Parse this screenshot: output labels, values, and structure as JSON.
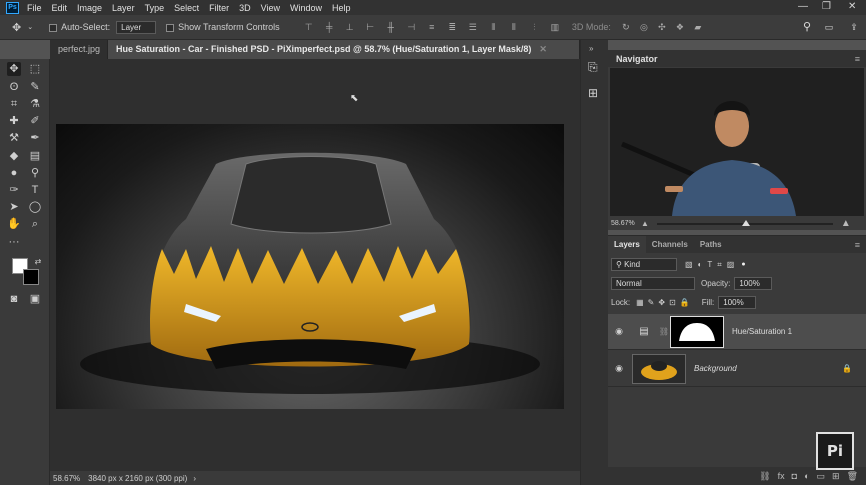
{
  "app": {
    "logo": "Ps"
  },
  "menu": [
    "File",
    "Edit",
    "Image",
    "Layer",
    "Type",
    "Select",
    "Filter",
    "3D",
    "View",
    "Window",
    "Help"
  ],
  "window_controls": {
    "minimize": "—",
    "restore": "❐",
    "close": "✕"
  },
  "options": {
    "auto_select_label": "Auto-Select:",
    "auto_select_value": "Layer",
    "transform_label": "Show Transform Controls",
    "mode3d_label": "3D Mode:"
  },
  "tabs": [
    {
      "label": "perfect.jpg"
    },
    {
      "label": "Hue Saturation - Car - Finished PSD - PiXimperfect.psd @ 58.7% (Hue/Saturation 1, Layer Mask/8)"
    }
  ],
  "status": {
    "zoom": "58.67%",
    "dimensions": "3840 px x 2160 px (300 ppi)",
    "arrow": "›"
  },
  "navigator": {
    "title": "Navigator",
    "zoom": "58.67%"
  },
  "layers_panel": {
    "tabs": [
      "Layers",
      "Channels",
      "Paths"
    ],
    "filter_kind": "Kind",
    "blend_mode": "Normal",
    "opacity_label": "Opacity:",
    "opacity_value": "100%",
    "lock_label": "Lock:",
    "fill_label": "Fill:",
    "fill_value": "100%",
    "layers": [
      {
        "name": "Hue/Saturation 1"
      },
      {
        "name": "Background"
      }
    ]
  },
  "colors": {
    "car_accent": "#e0a21c",
    "panel": "#3a3a3a",
    "canvas_bg": "#2f2f2f"
  },
  "watermark": {
    "text": "Pi"
  }
}
